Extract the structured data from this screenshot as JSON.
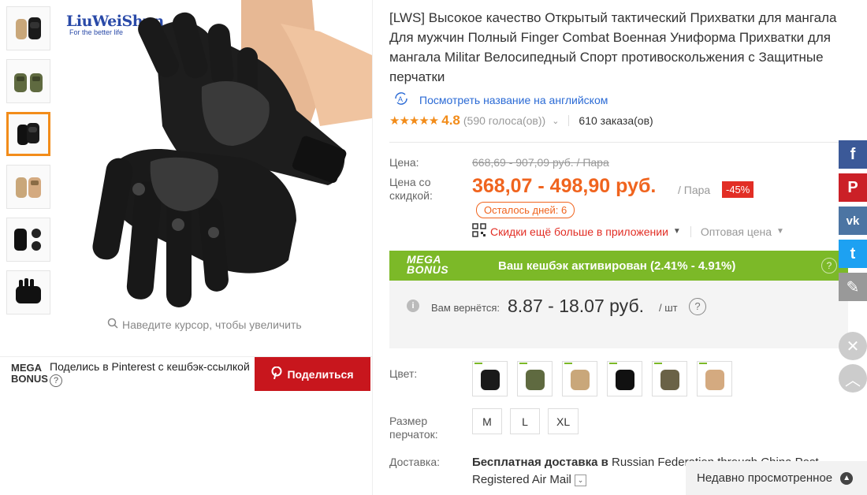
{
  "brand": {
    "name": "LiuWeiShun",
    "tagline": "For the better life"
  },
  "gallery": {
    "zoom_hint": "Наведите курсор, чтобы увеличить",
    "active_index": 2,
    "thumbnails": [
      "thumb-1",
      "thumb-2",
      "thumb-3",
      "thumb-4",
      "thumb-5",
      "thumb-6"
    ]
  },
  "share": {
    "mega_label": "MEGA BONUS",
    "text": "Поделись в Pinterest с кешбэк-ссылкой",
    "help": "?",
    "button_label": "Поделиться"
  },
  "product": {
    "title": "[LWS] Высокое качество Открытый тактический Прихватки для мангала Для мужчин Полный Finger Combat Военная Униформа Прихватки для мангала Militar Велосипедный Спорт противоскольжения с Защитные перчатки",
    "english_link": "Посмотреть название на английском",
    "stars": "★★★★★",
    "rating": "4.8",
    "votes": "(590 голоса(ов))",
    "orders": "610 заказа(ов)"
  },
  "price": {
    "label": "Цена:",
    "old": "668,69 - 907,09 руб. / Пара",
    "discount_label": "Цена со скидкой:",
    "new": "368,07 - 498,90 руб.",
    "per_unit": "/ Пара",
    "discount": "-45%",
    "days_left": "Осталось дней: 6",
    "app_link": "Скидки ещё больше в приложении",
    "wholesale": "Оптовая цена"
  },
  "mega_bonus": {
    "logo_line1": "MEGA",
    "logo_line2": "BONUS",
    "text": "Ваш кешбэк активирован (2.41% - 4.91%)",
    "help": "?",
    "cashback_label": "Вам вернётся:",
    "cashback_value": "8.87 - 18.07 руб.",
    "cashback_unit": "/ шт",
    "info": "i"
  },
  "options": {
    "color_label": "Цвет:",
    "size_label": "Размер перчаток:",
    "sizes": [
      "M",
      "L",
      "XL"
    ],
    "swatch_colors": [
      "#1a1a1a",
      "#5f6a40",
      "#c9a77a",
      "#111111",
      "#6a6247",
      "#d4aa80"
    ]
  },
  "delivery": {
    "label": "Доставка:",
    "line1_bold": "Бесплатная доставка в",
    "line1_rest": "Russian Federation through China Post",
    "line2": "Registered Air Mail"
  },
  "social": {
    "items": [
      {
        "name": "facebook",
        "glyph": "f",
        "color": "#3b5998"
      },
      {
        "name": "pinterest",
        "glyph": "P",
        "color": "#cb2027"
      },
      {
        "name": "vk",
        "glyph": "vk",
        "color": "#4c75a3"
      },
      {
        "name": "twitter",
        "glyph": "t",
        "color": "#1da1f2"
      },
      {
        "name": "edit",
        "glyph": "✎",
        "color": "#999999"
      }
    ]
  },
  "recent": {
    "label": "Недавно просмотренное"
  }
}
